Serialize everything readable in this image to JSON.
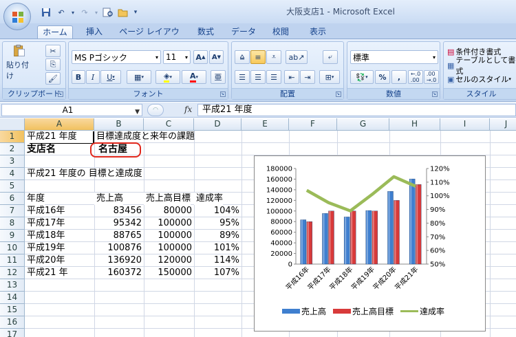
{
  "window": {
    "title": "大阪支店1 - Microsoft Excel"
  },
  "qat": {
    "icons": [
      "save-icon",
      "undo-icon",
      "redo-icon",
      "print-preview-icon",
      "open-icon",
      "customize-icon"
    ]
  },
  "ribbon": {
    "tabs": [
      "ホーム",
      "挿入",
      "ページ レイアウト",
      "数式",
      "データ",
      "校閲",
      "表示"
    ],
    "active_tab": "ホーム",
    "clipboard": {
      "label": "クリップボード",
      "paste": "貼り付け"
    },
    "font": {
      "label": "フォント",
      "name": "MS Pゴシック",
      "size": "11",
      "bold": "B",
      "italic": "I",
      "underline": "U",
      "grow": "A",
      "shrink": "A"
    },
    "alignment": {
      "label": "配置"
    },
    "number": {
      "label": "数値",
      "format": "標準",
      "percent": "%",
      "comma": ","
    },
    "styles": {
      "label": "スタイル",
      "cond": "条件付き書式",
      "table": "テーブルとして書式",
      "cell": "セルのスタイル"
    }
  },
  "formula_bar": {
    "name_box": "A1",
    "fx": "fx",
    "value": "平成21 年度"
  },
  "columns": [
    "A",
    "B",
    "C",
    "D",
    "E",
    "F",
    "G",
    "H",
    "I",
    "J"
  ],
  "rows": [
    "1",
    "2",
    "3",
    "4",
    "5",
    "6",
    "7",
    "8",
    "9",
    "10",
    "11",
    "12",
    "13",
    "14",
    "15",
    "16",
    "17"
  ],
  "sheet": {
    "a1": "平成21 年度",
    "b1": "目標達成度と来年の課題",
    "a2": "支店名",
    "b2": "名古屋",
    "a4": "平成21 年度の 目標と達成度",
    "headers": [
      "年度",
      "売上高",
      "売上高目標",
      "達成率"
    ],
    "table": [
      [
        "平成16年",
        "83456",
        "80000",
        "104%"
      ],
      [
        "平成17年",
        "95342",
        "100000",
        "95%"
      ],
      [
        "平成18年",
        "88765",
        "100000",
        "89%"
      ],
      [
        "平成19年",
        "100876",
        "100000",
        "101%"
      ],
      [
        "平成20年",
        "136920",
        "120000",
        "114%"
      ],
      [
        "平成21 年",
        "160372",
        "150000",
        "107%"
      ]
    ]
  },
  "chart_data": {
    "type": "bar",
    "categories": [
      "平成16年",
      "平成17年",
      "平成18年",
      "平成19年",
      "平成20年",
      "平成21年"
    ],
    "series": [
      {
        "name": "売上高",
        "type": "bar",
        "axis": "left",
        "color": "#3f7fcf",
        "values": [
          83456,
          95342,
          88765,
          100876,
          136920,
          160372
        ]
      },
      {
        "name": "売上高目標",
        "type": "bar",
        "axis": "left",
        "color": "#d83a3a",
        "values": [
          80000,
          100000,
          100000,
          100000,
          120000,
          150000
        ]
      },
      {
        "name": "達成率",
        "type": "line",
        "axis": "right",
        "color": "#9bbb59",
        "values": [
          104,
          95,
          89,
          101,
          114,
          107
        ]
      }
    ],
    "ylim": [
      0,
      180000
    ],
    "yticks": [
      "0",
      "20000",
      "40000",
      "60000",
      "80000",
      "100000",
      "120000",
      "140000",
      "160000",
      "180000"
    ],
    "y2lim": [
      50,
      120
    ],
    "y2ticks": [
      "50%",
      "60%",
      "70%",
      "80%",
      "90%",
      "100%",
      "110%",
      "120%"
    ],
    "legend": "bottom",
    "grid": false
  }
}
